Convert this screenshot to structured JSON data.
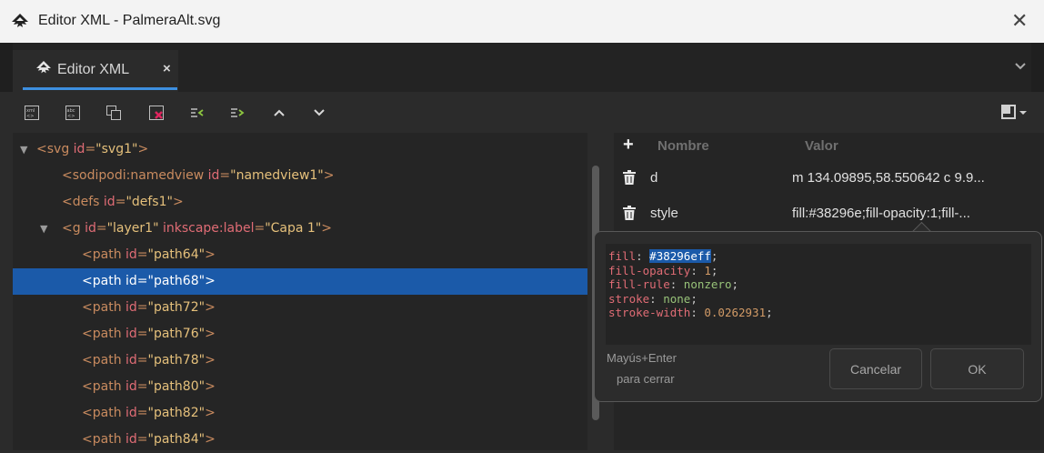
{
  "window": {
    "title": "Editor XML - PalmeraAlt.svg",
    "close_glyph": "✕"
  },
  "tabs": [
    {
      "label": "Editor XML",
      "close_glyph": "×"
    }
  ],
  "tabbar": {
    "dropdown_glyph": "⌵"
  },
  "toolbar": {
    "buttons": [
      "new-element-node-icon",
      "new-text-node-icon",
      "duplicate-node-icon",
      "delete-node-icon",
      "unindent-node-icon",
      "indent-node-icon",
      "raise-node-icon",
      "lower-node-icon"
    ],
    "layout_icon": "panel-layout-icon"
  },
  "tree": {
    "rows": [
      {
        "indent": 0,
        "expander": "▼",
        "tag": "svg",
        "attrs": [
          {
            "k": "id",
            "v": "\"svg1\""
          }
        ]
      },
      {
        "indent": 1,
        "expander": "",
        "tag": "sodipodi:namedview",
        "attrs": [
          {
            "k": "id",
            "v": "\"namedview1\""
          }
        ]
      },
      {
        "indent": 1,
        "expander": "",
        "tag": "defs",
        "attrs": [
          {
            "k": "id",
            "v": "\"defs1\""
          }
        ]
      },
      {
        "indent": 1,
        "expander": "▼",
        "tag": "g",
        "attrs": [
          {
            "k": "id",
            "v": "\"layer1\""
          },
          {
            "k": "inkscape:label",
            "v": "\"Capa 1\""
          }
        ]
      },
      {
        "indent": 2,
        "expander": "",
        "tag": "path",
        "attrs": [
          {
            "k": "id",
            "v": "\"path64\""
          }
        ]
      },
      {
        "indent": 2,
        "expander": "",
        "tag": "path",
        "attrs": [
          {
            "k": "id",
            "v": "\"path68\""
          }
        ],
        "selected": true
      },
      {
        "indent": 2,
        "expander": "",
        "tag": "path",
        "attrs": [
          {
            "k": "id",
            "v": "\"path72\""
          }
        ]
      },
      {
        "indent": 2,
        "expander": "",
        "tag": "path",
        "attrs": [
          {
            "k": "id",
            "v": "\"path76\""
          }
        ]
      },
      {
        "indent": 2,
        "expander": "",
        "tag": "path",
        "attrs": [
          {
            "k": "id",
            "v": "\"path78\""
          }
        ]
      },
      {
        "indent": 2,
        "expander": "",
        "tag": "path",
        "attrs": [
          {
            "k": "id",
            "v": "\"path80\""
          }
        ]
      },
      {
        "indent": 2,
        "expander": "",
        "tag": "path",
        "attrs": [
          {
            "k": "id",
            "v": "\"path82\""
          }
        ]
      },
      {
        "indent": 2,
        "expander": "",
        "tag": "path",
        "attrs": [
          {
            "k": "id",
            "v": "\"path84\""
          }
        ]
      }
    ]
  },
  "attributes": {
    "add_glyph": "+",
    "header_name": "Nombre",
    "header_value": "Valor",
    "rows": [
      {
        "name": "d",
        "value": "m 134.09895,58.550642 c 9.9..."
      },
      {
        "name": "style",
        "value": "fill:#38296e;fill-opacity:1;fill-..."
      }
    ]
  },
  "style_editor": {
    "lines": [
      {
        "prop": "fill",
        "value": "#38296eff",
        "selected": true,
        "kind": "num"
      },
      {
        "prop": "fill-opacity",
        "value": "1",
        "kind": "num"
      },
      {
        "prop": "fill-rule",
        "value": "nonzero",
        "kind": "ident"
      },
      {
        "prop": "stroke",
        "value": "none",
        "kind": "ident"
      },
      {
        "prop": "stroke-width",
        "value": "0.0262931",
        "kind": "num"
      }
    ],
    "hint_line1": "Mayús+Enter",
    "hint_line2": "para cerrar",
    "cancel_label": "Cancelar",
    "ok_label": "OK"
  },
  "colors": {
    "selection": "#1b5aa9",
    "accent": "#3d8fe0",
    "background": "#2b2b2b"
  }
}
